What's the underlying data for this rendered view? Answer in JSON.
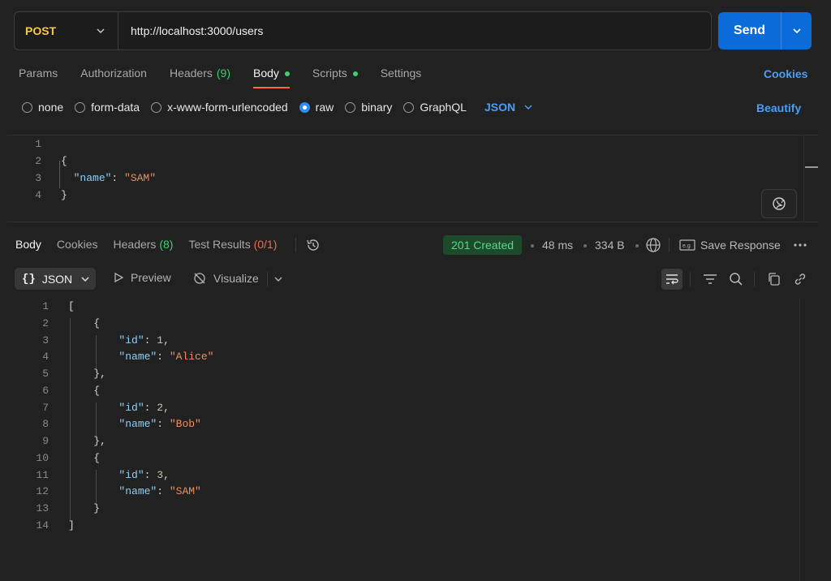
{
  "request": {
    "method": "POST",
    "url": "http://localhost:3000/users",
    "send_label": "Send"
  },
  "request_tabs": [
    {
      "label": "Params",
      "count": "",
      "dot": false,
      "active": false
    },
    {
      "label": "Authorization",
      "count": "",
      "dot": false,
      "active": false
    },
    {
      "label": "Headers",
      "count": "(9)",
      "dot": false,
      "active": false
    },
    {
      "label": "Body",
      "count": "",
      "dot": true,
      "active": true
    },
    {
      "label": "Scripts",
      "count": "",
      "dot": true,
      "active": false
    },
    {
      "label": "Settings",
      "count": "",
      "dot": false,
      "active": false
    }
  ],
  "cookies_label": "Cookies",
  "body_types": [
    {
      "label": "none",
      "checked": false
    },
    {
      "label": "form-data",
      "checked": false
    },
    {
      "label": "x-www-form-urlencoded",
      "checked": false
    },
    {
      "label": "raw",
      "checked": true
    },
    {
      "label": "binary",
      "checked": false
    },
    {
      "label": "GraphQL",
      "checked": false
    }
  ],
  "raw_language": "JSON",
  "beautify_label": "Beautify",
  "request_body_lines": [
    {
      "n": "1",
      "tokens": []
    },
    {
      "n": "2",
      "tokens": [
        {
          "t": "p",
          "v": "{"
        }
      ]
    },
    {
      "n": "3",
      "tokens": [
        {
          "t": "p",
          "v": "  "
        },
        {
          "t": "k",
          "v": "\"name\""
        },
        {
          "t": "p",
          "v": ": "
        },
        {
          "t": "s",
          "v": "\"SAM\""
        }
      ]
    },
    {
      "n": "4",
      "tokens": [
        {
          "t": "p",
          "v": "}"
        }
      ]
    }
  ],
  "response_tabs": [
    {
      "label": "Body",
      "count": "",
      "active": true,
      "error": false
    },
    {
      "label": "Cookies",
      "count": "",
      "active": false,
      "error": false
    },
    {
      "label": "Headers",
      "count": "(8)",
      "active": false,
      "error": false
    },
    {
      "label": "Test Results",
      "count": "(0/1)",
      "active": false,
      "error": true
    }
  ],
  "response_meta": {
    "status": "201 Created",
    "time": "48 ms",
    "size": "334 B",
    "save_label": "Save Response"
  },
  "response_toolbar": {
    "format": "JSON",
    "preview": "Preview",
    "visualize": "Visualize"
  },
  "response_body_lines": [
    {
      "n": "1",
      "tokens": [
        {
          "t": "p",
          "v": "["
        }
      ]
    },
    {
      "n": "2",
      "tokens": [
        {
          "t": "p",
          "v": "    {"
        }
      ]
    },
    {
      "n": "3",
      "tokens": [
        {
          "t": "p",
          "v": "        "
        },
        {
          "t": "k",
          "v": "\"id\""
        },
        {
          "t": "p",
          "v": ": "
        },
        {
          "t": "n",
          "v": "1"
        },
        {
          "t": "p",
          "v": ","
        }
      ]
    },
    {
      "n": "4",
      "tokens": [
        {
          "t": "p",
          "v": "        "
        },
        {
          "t": "k",
          "v": "\"name\""
        },
        {
          "t": "p",
          "v": ": "
        },
        {
          "t": "s",
          "v": "\"Alice\""
        }
      ]
    },
    {
      "n": "5",
      "tokens": [
        {
          "t": "p",
          "v": "    },"
        }
      ]
    },
    {
      "n": "6",
      "tokens": [
        {
          "t": "p",
          "v": "    {"
        }
      ]
    },
    {
      "n": "7",
      "tokens": [
        {
          "t": "p",
          "v": "        "
        },
        {
          "t": "k",
          "v": "\"id\""
        },
        {
          "t": "p",
          "v": ": "
        },
        {
          "t": "n",
          "v": "2"
        },
        {
          "t": "p",
          "v": ","
        }
      ]
    },
    {
      "n": "8",
      "tokens": [
        {
          "t": "p",
          "v": "        "
        },
        {
          "t": "k",
          "v": "\"name\""
        },
        {
          "t": "p",
          "v": ": "
        },
        {
          "t": "s",
          "v": "\"Bob\""
        }
      ]
    },
    {
      "n": "9",
      "tokens": [
        {
          "t": "p",
          "v": "    },"
        }
      ]
    },
    {
      "n": "10",
      "tokens": [
        {
          "t": "p",
          "v": "    {"
        }
      ]
    },
    {
      "n": "11",
      "tokens": [
        {
          "t": "p",
          "v": "        "
        },
        {
          "t": "k",
          "v": "\"id\""
        },
        {
          "t": "p",
          "v": ": "
        },
        {
          "t": "n",
          "v": "3"
        },
        {
          "t": "p",
          "v": ","
        }
      ]
    },
    {
      "n": "12",
      "tokens": [
        {
          "t": "p",
          "v": "        "
        },
        {
          "t": "k",
          "v": "\"name\""
        },
        {
          "t": "p",
          "v": ": "
        },
        {
          "t": "s",
          "v": "\"SAM\""
        }
      ]
    },
    {
      "n": "13",
      "tokens": [
        {
          "t": "p",
          "v": "    }"
        }
      ]
    },
    {
      "n": "14",
      "tokens": [
        {
          "t": "p",
          "v": "]"
        }
      ]
    }
  ],
  "colors": {
    "accent": "#0b6bd9",
    "method": "#f5c846",
    "active_tab_underline": "#ff6c37",
    "success": "#3ecf6e",
    "error": "#f06a5a",
    "link": "#4a9ef5"
  }
}
